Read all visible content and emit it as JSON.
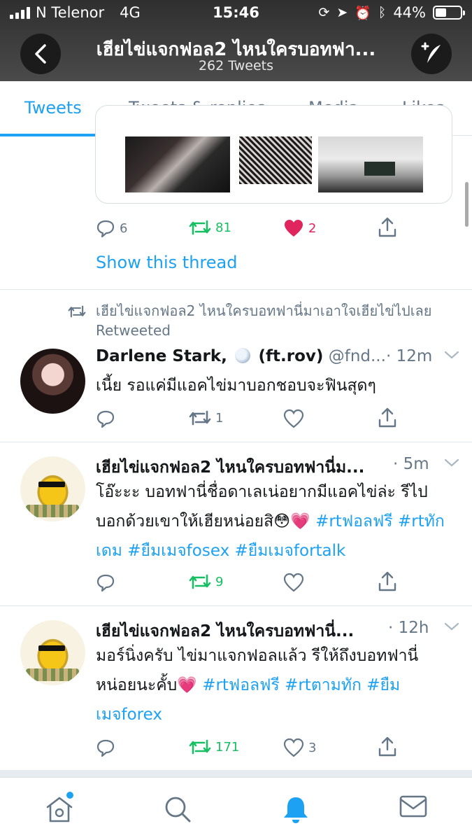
{
  "status_bar": {
    "carrier": "N Telenor",
    "network": "4G",
    "time": "15:46",
    "battery": "44%",
    "battery_level": 0.44
  },
  "header": {
    "title": "เฮียไข่แจกฟอล2 ไหนใครบอทฟา...",
    "subtitle": "262 Tweets"
  },
  "tabs": [
    "Tweets",
    "Tweets & replies",
    "Media",
    "Likes"
  ],
  "active_tab": "Tweets",
  "tweet_prev": {
    "replies": "6",
    "retweets": "81",
    "likes": "2",
    "show_thread": "Show this thread"
  },
  "tweets": [
    {
      "retweet_label": "เฮียไข่แจกฟอล2 ไหนใครบอทฟานี่มาเอาใจเฮียไข่ไปเลย Retweeted",
      "name": "Darlene Stark,",
      "name_suffix": "(ft.rov)",
      "handle": "@fnd...",
      "time": "· 12m",
      "text": "เนี้ย รอแค่มีแอคไข่มาบอกชอบจะฟินสุดๆ",
      "replies": "",
      "retweets": "1",
      "likes": ""
    },
    {
      "name": "เฮียไข่แจกฟอล2 ไหนใครบอทฟานี่ม...",
      "time": "· 5m",
      "text": "โอ๊ะะะ บอทฟานี่ชื่อดาเลเน่อยากมีแอคไข่ล่ะ รีไปบอกด้วยเขาให้เฮียหน่อยสิ😳💗",
      "tags": "#rtฟอลฟรี #rtทักเดม #ยืมเมจfosex #ยืมเมจfortalk",
      "replies": "",
      "retweets": "9",
      "likes": ""
    },
    {
      "name": "เฮียไข่แจกฟอล2 ไหนใครบอทฟานี่...",
      "time": "· 12h",
      "text": "มอร์นิ่งครับ ไข่มาแจกฟอลแล้ว รีให้ถึงบอทฟานี่หน่อยนะคั้บ💗",
      "tags": "#rtฟอลฟรี #rtตามทัก #ยืมเมจforex",
      "replies": "",
      "retweets": "171",
      "likes": "3"
    }
  ],
  "colors": {
    "accent": "#1da1f2",
    "retweet": "#17bf63",
    "like": "#e0245e",
    "muted": "#657786"
  },
  "bottom_nav": [
    "home-icon",
    "search-icon",
    "notifications-icon",
    "messages-icon"
  ]
}
